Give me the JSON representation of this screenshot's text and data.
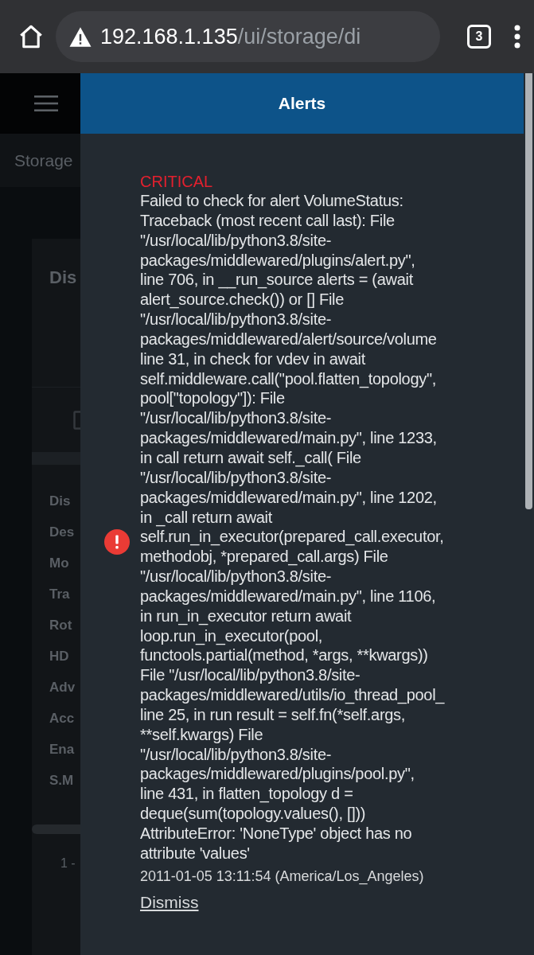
{
  "browser": {
    "url_host": "192.168.1.135",
    "url_path": "/ui/storage/di",
    "tab_count": "3"
  },
  "background": {
    "breadcrumb": "Storage",
    "card_title": "Dis",
    "rows": [
      "Dis",
      "Des",
      "Mo",
      "Tra",
      "Rot",
      "HD",
      "Adv",
      "Acc",
      "Ena",
      "S.M"
    ],
    "pager": "1 -"
  },
  "alerts_panel": {
    "title": "Alerts",
    "alerts": [
      {
        "level": "CRITICAL",
        "message_lines": [
          "Failed to check for alert VolumeStatus:",
          "Traceback (most recent call last): File",
          "\"/usr/local/lib/python3.8/site-",
          "packages/middlewared/plugins/alert.py\",",
          "line 706, in __run_source alerts = (await",
          "alert_source.check()) or [] File",
          "\"/usr/local/lib/python3.8/site-",
          "packages/middlewared/alert/source/volume",
          "line 31, in check for vdev in await",
          "self.middleware.call(\"pool.flatten_topology\",",
          "pool[\"topology\"]): File",
          "\"/usr/local/lib/python3.8/site-",
          "packages/middlewared/main.py\", line 1233,",
          "in call return await self._call( File",
          "\"/usr/local/lib/python3.8/site-",
          "packages/middlewared/main.py\", line 1202,",
          "in _call return await",
          "self.run_in_executor(prepared_call.executor,",
          "methodobj, *prepared_call.args) File",
          "\"/usr/local/lib/python3.8/site-",
          "packages/middlewared/main.py\", line 1106,",
          "in run_in_executor return await",
          "loop.run_in_executor(pool,",
          "functools.partial(method, *args, **kwargs))",
          "File \"/usr/local/lib/python3.8/site-",
          "packages/middlewared/utils/io_thread_pool_",
          "line 25, in run result = self.fn(*self.args,",
          "**self.kwargs) File",
          "\"/usr/local/lib/python3.8/site-",
          "packages/middlewared/plugins/pool.py\",",
          "line 431, in flatten_topology d =",
          "deque(sum(topology.values(), []))",
          "AttributeError: 'NoneType' object has no",
          "attribute 'values'"
        ],
        "timestamp": "2011-01-05 13:11:54 (America/Los_Angeles)",
        "action": "Dismiss"
      }
    ]
  }
}
